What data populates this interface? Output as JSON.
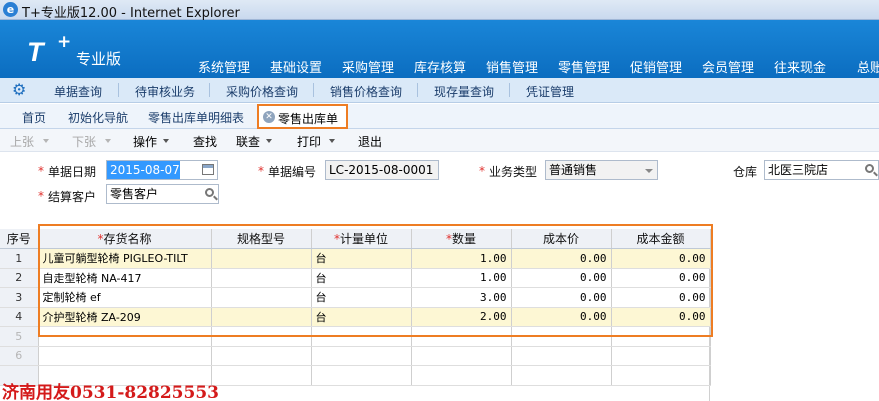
{
  "window": {
    "title": "T+专业版12.00 - Internet Explorer",
    "ie_icon": "e"
  },
  "header": {
    "logo_letter": "T",
    "logo_plus": "+",
    "logo_text": "专业版",
    "nav": [
      "系统管理",
      "基础设置",
      "采购管理",
      "库存核算",
      "销售管理",
      "零售管理",
      "促销管理",
      "会员管理",
      "往来现金",
      "总账"
    ]
  },
  "subnav": {
    "gear_icon": "⚙",
    "items": [
      "单据查询",
      "待审核业务",
      "采购价格查询",
      "销售价格查询",
      "现存量查询",
      "凭证管理"
    ]
  },
  "tabs": {
    "items": [
      "首页",
      "初始化导航",
      "零售出库单明细表"
    ],
    "active": "零售出库单"
  },
  "toolbar": {
    "prev": "上张",
    "next": "下张",
    "operate": "操作",
    "find": "查找",
    "link": "联查",
    "print": "打印",
    "exit": "退出"
  },
  "form": {
    "date_label": "单据日期",
    "date_value": "2015-08-07",
    "code_label": "单据编号",
    "code_value": "LC-2015-08-0001",
    "biztype_label": "业务类型",
    "biztype_value": "普通销售",
    "warehouse_label": "仓库",
    "warehouse_value": "北医三院店",
    "customer_label": "结算客户",
    "customer_value": "零售客户",
    "required_mark": "*"
  },
  "grid": {
    "headers": {
      "idx": "序号",
      "name": "存货名称",
      "spec": "规格型号",
      "unit": "计量单位",
      "qty": "数量",
      "cost_price": "成本价",
      "cost_amount": "成本金额"
    },
    "rows": [
      {
        "idx": "1",
        "name": "儿童可躺型轮椅 PIGLEO-TILT",
        "spec": "",
        "unit": "台",
        "qty": "1.00",
        "price": "0.00",
        "amount": "0.00"
      },
      {
        "idx": "2",
        "name": "自走型轮椅 NA-417",
        "spec": "",
        "unit": "台",
        "qty": "1.00",
        "price": "0.00",
        "amount": "0.00"
      },
      {
        "idx": "3",
        "name": "定制轮椅 ef",
        "spec": "",
        "unit": "台",
        "qty": "3.00",
        "price": "0.00",
        "amount": "0.00"
      },
      {
        "idx": "4",
        "name": "介护型轮椅 ZA-209",
        "spec": "",
        "unit": "台",
        "qty": "2.00",
        "price": "0.00",
        "amount": "0.00"
      }
    ],
    "empty_rows": [
      "5",
      "6"
    ]
  },
  "watermark": "济南用友0531-82825553",
  "colors": {
    "header_blue": "#0b6dc0",
    "accent_orange": "#ee7d23",
    "required_red": "#e0312e",
    "row_highlight": "#fdf7d4"
  }
}
